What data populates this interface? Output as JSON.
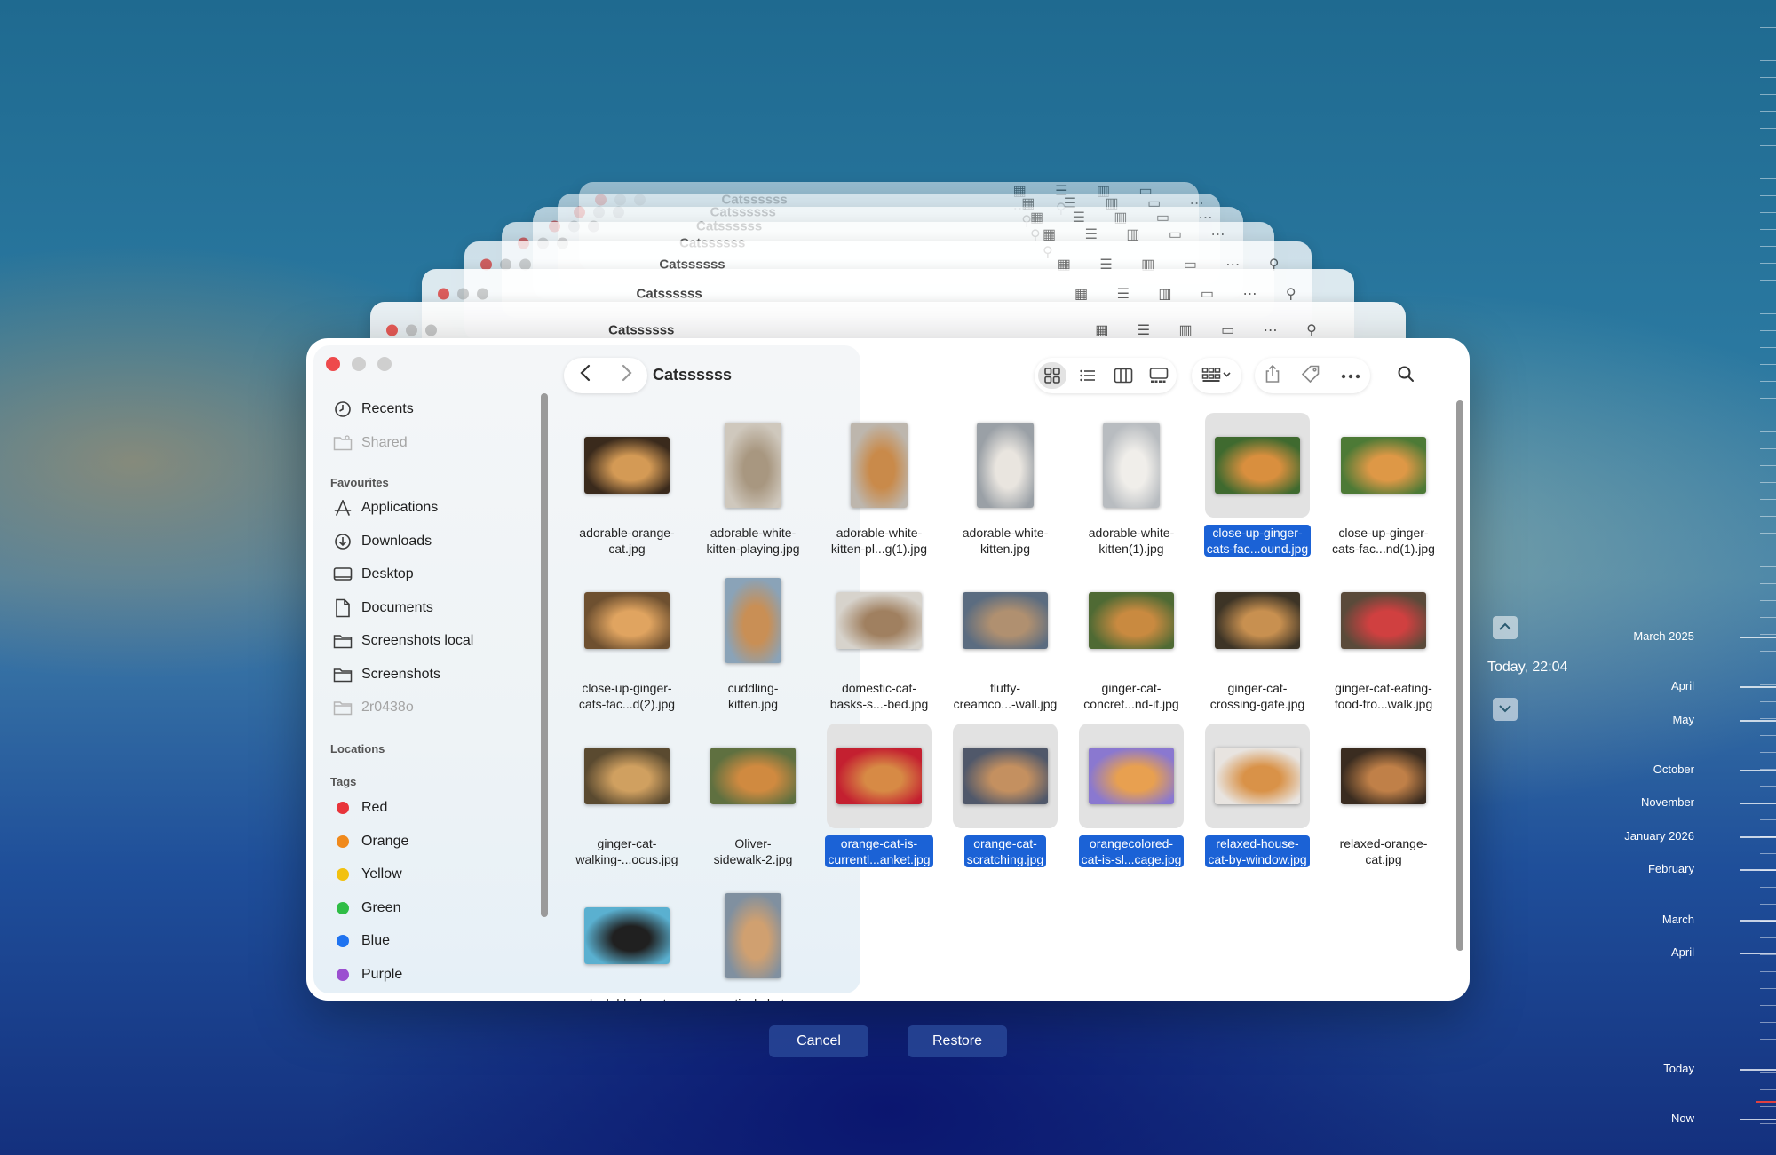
{
  "window": {
    "title": "Catssssss",
    "ghost_titles": [
      "Catssssss",
      "Catssssss",
      "Catssssss",
      "Catssssss",
      "Catssssss",
      "Catssssss",
      "Catssssss"
    ]
  },
  "sidebar": {
    "top_items": [
      {
        "label": "Recents",
        "icon": "clock-icon",
        "dim": false
      },
      {
        "label": "Shared",
        "icon": "shared-folder-icon",
        "dim": true
      }
    ],
    "favourites_heading": "Favourites",
    "favourites": [
      {
        "label": "Applications",
        "icon": "applications-icon"
      },
      {
        "label": "Downloads",
        "icon": "download-icon"
      },
      {
        "label": "Desktop",
        "icon": "desktop-icon"
      },
      {
        "label": "Documents",
        "icon": "document-icon"
      },
      {
        "label": "Screenshots local",
        "icon": "folder-icon"
      },
      {
        "label": "Screenshots",
        "icon": "folder-icon"
      },
      {
        "label": "2r0438o",
        "icon": "folder-icon",
        "dim": true
      }
    ],
    "locations_heading": "Locations",
    "tags_heading": "Tags",
    "tags": [
      {
        "label": "Red",
        "color": "#e8343a"
      },
      {
        "label": "Orange",
        "color": "#f08a1c"
      },
      {
        "label": "Yellow",
        "color": "#f2c10f"
      },
      {
        "label": "Green",
        "color": "#2fbd46"
      },
      {
        "label": "Blue",
        "color": "#1f73f0"
      },
      {
        "label": "Purple",
        "color": "#9b4fd0"
      }
    ]
  },
  "files": [
    {
      "name": "adorable-orange-\ncat.jpg",
      "orient": "land",
      "c1": "#3a2a1c",
      "c2": "#d49a55",
      "selected": false
    },
    {
      "name": "adorable-white-\nkitten-playing.jpg",
      "orient": "port",
      "c1": "#cfc8bd",
      "c2": "#a89780",
      "selected": false
    },
    {
      "name": "adorable-white-\nkitten-pl...g(1).jpg",
      "orient": "port",
      "c1": "#bdb6ad",
      "c2": "#c98a4a",
      "selected": false
    },
    {
      "name": "adorable-white-\nkitten.jpg",
      "orient": "port",
      "c1": "#9aa0a6",
      "c2": "#e9e5df",
      "selected": false
    },
    {
      "name": "adorable-white-\nkitten(1).jpg",
      "orient": "port",
      "c1": "#b8bcc0",
      "c2": "#f0eeea",
      "selected": false
    },
    {
      "name": "close-up-ginger-\ncats-fac...ound.jpg",
      "orient": "land",
      "c1": "#3f6a2f",
      "c2": "#d98f3e",
      "selected": true
    },
    {
      "name": "close-up-ginger-\ncats-fac...nd(1).jpg",
      "orient": "land",
      "c1": "#4d7a36",
      "c2": "#de9846",
      "selected": false
    },
    {
      "name": "close-up-ginger-\ncats-fac...d(2).jpg",
      "orient": "land",
      "c1": "#6e5030",
      "c2": "#e0a460",
      "selected": false
    },
    {
      "name": "cuddling-\nkitten.jpg",
      "orient": "port",
      "c1": "#8aa3b8",
      "c2": "#c98f55",
      "selected": false
    },
    {
      "name": "domestic-cat-\nbasks-s...-bed.jpg",
      "orient": "land",
      "c1": "#d7d3cc",
      "c2": "#a08060",
      "selected": false
    },
    {
      "name": "fluffy-\ncreamco...-wall.jpg",
      "orient": "land",
      "c1": "#5b6c80",
      "c2": "#b09070",
      "selected": false
    },
    {
      "name": "ginger-cat-\nconcret...nd-it.jpg",
      "orient": "land",
      "c1": "#4f6a34",
      "c2": "#c98a40",
      "selected": false
    },
    {
      "name": "ginger-cat-\ncrossing-gate.jpg",
      "orient": "land",
      "c1": "#3d3426",
      "c2": "#c89050",
      "selected": false
    },
    {
      "name": "ginger-cat-eating-\nfood-fro...walk.jpg",
      "orient": "land",
      "c1": "#5a4a3a",
      "c2": "#d04040",
      "selected": false
    },
    {
      "name": "ginger-cat-\nwalking-...ocus.jpg",
      "orient": "land",
      "c1": "#5a4a30",
      "c2": "#d0a060",
      "selected": false
    },
    {
      "name": "Oliver-\nsidewalk-2.jpg",
      "orient": "land",
      "c1": "#5f7040",
      "c2": "#d08a40",
      "selected": false
    },
    {
      "name": "orange-cat-is-\ncurrentl...anket.jpg",
      "orient": "land",
      "c1": "#c42030",
      "c2": "#d78a45",
      "selected": true
    },
    {
      "name": "orange-cat-\nscratching.jpg",
      "orient": "land",
      "c1": "#50586a",
      "c2": "#c49060",
      "selected": true
    },
    {
      "name": "orangecolored-\ncat-is-sl...cage.jpg",
      "orient": "land",
      "c1": "#8a78d0",
      "c2": "#e8a050",
      "selected": true
    },
    {
      "name": "relaxed-house-\ncat-by-window.jpg",
      "orient": "land",
      "c1": "#e8e4e0",
      "c2": "#d99248",
      "selected": true
    },
    {
      "name": "relaxed-orange-\ncat.jpg",
      "orient": "land",
      "c1": "#3a2c20",
      "c2": "#c08048",
      "selected": false
    },
    {
      "name": "sleek-black-cat-",
      "orient": "land",
      "c1": "#5ab0d0",
      "c2": "#202020",
      "selected": false
    },
    {
      "name": "vertical-shot-",
      "orient": "port",
      "c1": "#8090a0",
      "c2": "#d0a070",
      "selected": false
    }
  ],
  "buttons": {
    "cancel": "Cancel",
    "restore": "Restore"
  },
  "time_machine": {
    "current": "Today, 22:04",
    "up_icon": "chevron-up-icon",
    "down_icon": "chevron-down-icon",
    "timeline": [
      "March 2025",
      "April",
      "May",
      "October",
      "November",
      "January 2026",
      "February",
      "March",
      "April",
      "Today",
      "Now"
    ]
  }
}
